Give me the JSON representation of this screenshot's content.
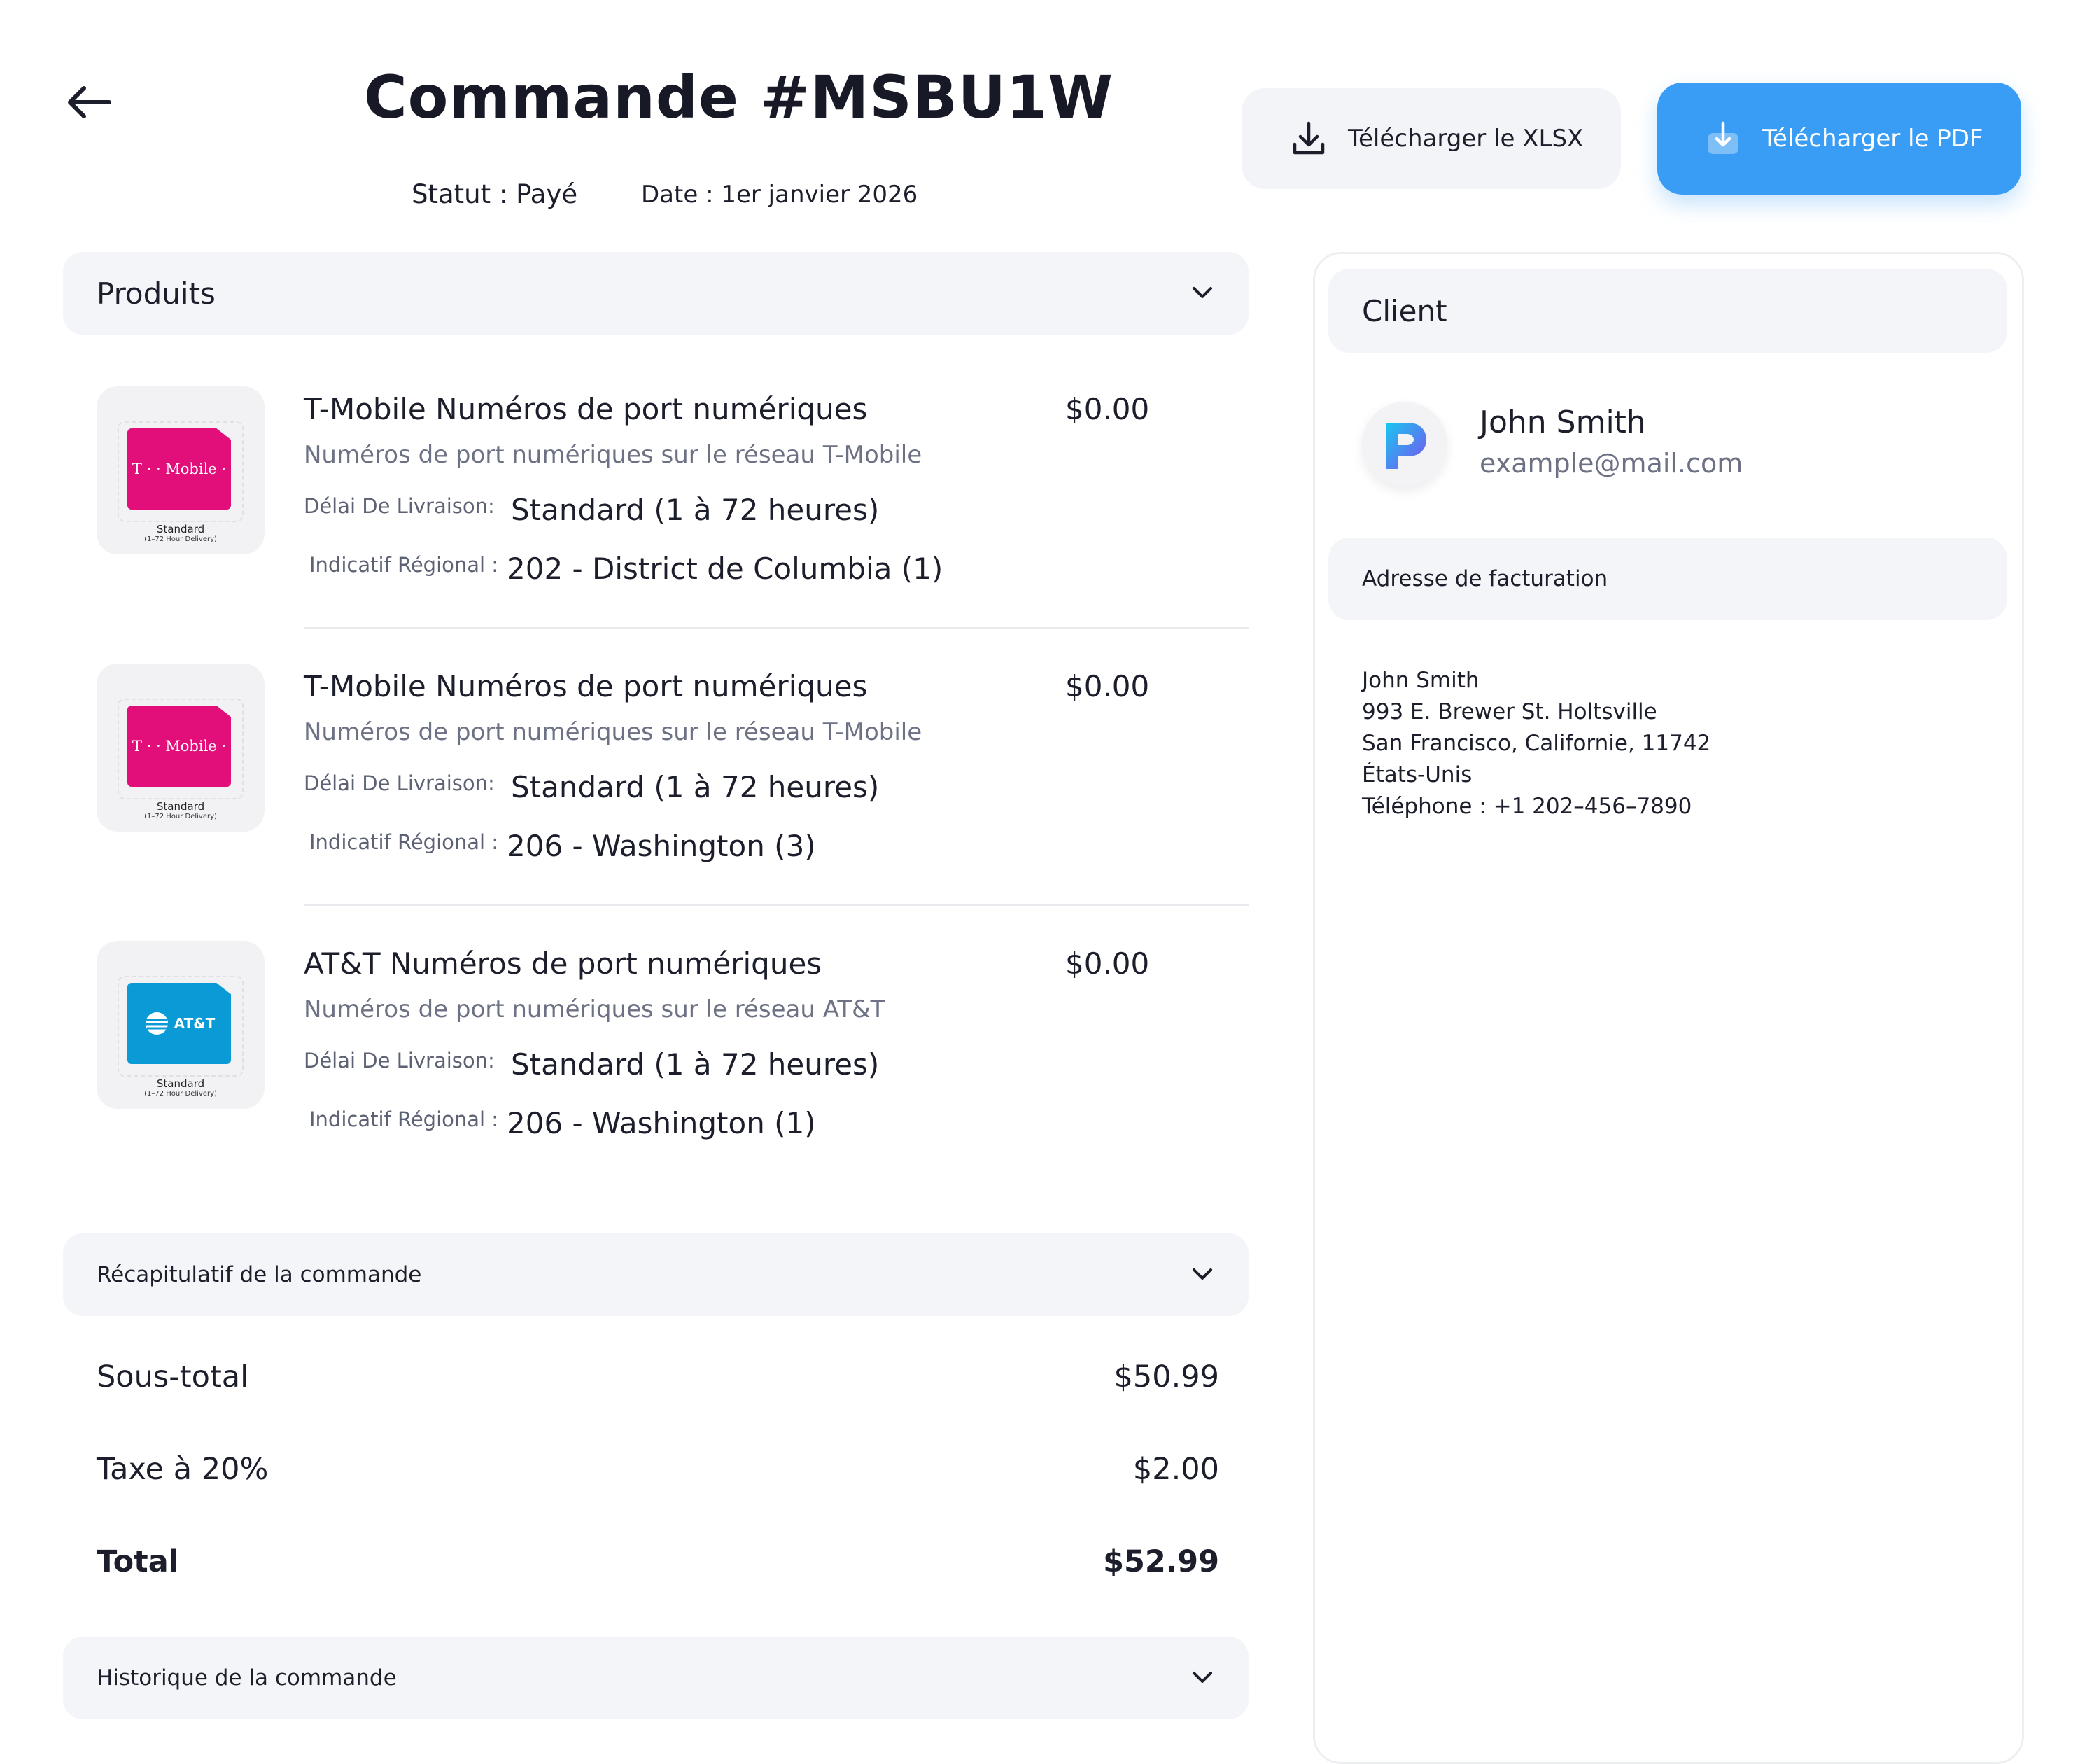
{
  "header": {
    "title": "Commande #MSBU1W",
    "status": "Statut : Payé",
    "date": "Date : 1er janvier 2026",
    "download_xlsx_label": "Télécharger le XLSX",
    "download_pdf_label": "Télécharger le PDF"
  },
  "colors": {
    "accent": "#3a9df5",
    "tmobile": "#e20f7a",
    "att": "#0a9bd6"
  },
  "products_section": {
    "title": "Produits",
    "items": [
      {
        "name": "T-Mobile Numéros de port numériques",
        "price": "$0.00",
        "description": "Numéros de port numériques sur le réseau T-Mobile",
        "delivery_label": "Délai De Livraison:",
        "delivery_value": "Standard (1 à 72 heures)",
        "area_label": "Indicatif Régional :",
        "area_value": "202 - District de Columbia (1)",
        "sim_brand": "T · · Mobile ·",
        "sim_caption": "Standard",
        "sim_subcaption": "(1–72 Hour Delivery)"
      },
      {
        "name": "T-Mobile Numéros de port numériques",
        "price": "$0.00",
        "description": "Numéros de port numériques sur le réseau T-Mobile",
        "delivery_label": "Délai De Livraison:",
        "delivery_value": "Standard (1 à 72 heures)",
        "area_label": "Indicatif Régional :",
        "area_value": "206 - Washington (3)",
        "sim_brand": "T · · Mobile ·",
        "sim_caption": "Standard",
        "sim_subcaption": "(1–72 Hour Delivery)"
      },
      {
        "name": "AT&T Numéros de port numériques",
        "price": "$0.00",
        "description": "Numéros de port numériques sur le réseau AT&T",
        "delivery_label": "Délai De Livraison:",
        "delivery_value": "Standard (1 à 72 heures)",
        "area_label": "Indicatif Régional :",
        "area_value": "206 - Washington (1)",
        "sim_brand": "AT&T",
        "sim_caption": "Standard",
        "sim_subcaption": "(1–72 Hour Delivery)"
      }
    ]
  },
  "summary": {
    "title": "Récapitulatif de la commande",
    "subtotal_label": "Sous-total",
    "subtotal_value": "$50.99",
    "tax_label": "Taxe à 20%",
    "tax_value": "$2.00",
    "total_label": "Total",
    "total_value": "$52.99"
  },
  "history": {
    "title": "Historique de la commande"
  },
  "client": {
    "title": "Client",
    "name": "John Smith",
    "email": "example@mail.com",
    "billing_title": "Adresse de facturation",
    "address": {
      "line1": "John Smith",
      "line2": "993 E. Brewer St. Holtsville",
      "line3": "San Francisco, Californie, 11742",
      "line4": "États-Unis",
      "line5": "Téléphone : +1 202–456–7890"
    }
  }
}
